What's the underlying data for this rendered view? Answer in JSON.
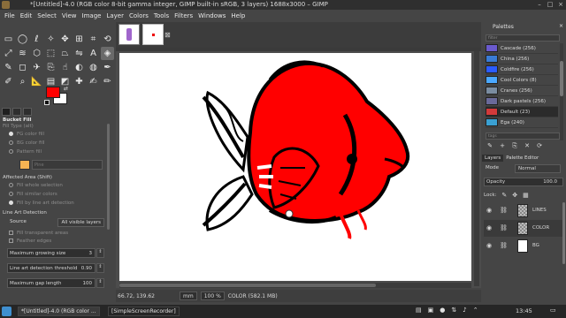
{
  "window": {
    "title": "*[Untitled]-4.0 (RGB color 8-bit gamma integer, GIMP built-in sRGB, 3 layers) 1688x3000 – GIMP"
  },
  "menu": [
    "File",
    "Edit",
    "Select",
    "View",
    "Image",
    "Layer",
    "Colors",
    "Tools",
    "Filters",
    "Windows",
    "Help"
  ],
  "colors": {
    "foreground": "#ff0000",
    "background": "#ffffff",
    "fish_fill": "#ff0000",
    "outline": "#000000"
  },
  "tool_options": {
    "title": "Bucket Fill",
    "fill_type_label": "Fill Type (alt)",
    "fill_types": [
      "FG color fill",
      "BG color fill",
      "Pattern fill"
    ],
    "pattern_name": "Pine",
    "affected_area_label": "Affected Area (Shift)",
    "areas": [
      "Fill whole selection",
      "Fill similar colors",
      "Fill by line art detection"
    ],
    "line_art_label": "Line Art Detection",
    "source_label": "Source",
    "source_value": "All visible layers",
    "fill_transparent": "Fill transparent areas",
    "feather_edges": "Feather edges",
    "max_growing_label": "Maximum growing size",
    "max_growing_value": "3",
    "threshold_label": "Line art detection threshold",
    "threshold_value": "0.90",
    "max_gap_label": "Maximum gap length",
    "max_gap_value": "100"
  },
  "status": {
    "coords": "66.72, 139.62",
    "unit": "mm",
    "zoom": "100 %",
    "info": "COLOR (582.1 MB)"
  },
  "palettes_panel": {
    "title": "Palettes",
    "search_placeholder": "filter",
    "items": [
      {
        "name": "Cascade (256)",
        "color": "#6a5acd"
      },
      {
        "name": "China (256)",
        "color": "#3a7bd5"
      },
      {
        "name": "Coldfire (256)",
        "color": "#2b5cff"
      },
      {
        "name": "Cool Colors (8)",
        "color": "#4aa8ff"
      },
      {
        "name": "Cranes (256)",
        "color": "#7a8ca0"
      },
      {
        "name": "Dark pastels (256)",
        "color": "#6a6a9a"
      },
      {
        "name": "Default (23)",
        "color": "#d23a3a"
      },
      {
        "name": "Ega (240)",
        "color": "#3aa0d2"
      }
    ],
    "tag_placeholder": "tags"
  },
  "layers_panel": {
    "tabs": [
      "Layers",
      "Palette Editor"
    ],
    "mode_label": "Mode",
    "mode_value": "Normal",
    "opacity_label": "Opacity",
    "opacity_value": "100.0",
    "lock_label": "Lock:",
    "layers": [
      {
        "name": "LINES"
      },
      {
        "name": "COLOR"
      },
      {
        "name": "BG"
      }
    ]
  },
  "taskbar": {
    "tasks": [
      "*[Untitled]-4.0 (RGB color ...",
      "[SimpleScreenRecorder]"
    ],
    "clock": "13:45"
  }
}
